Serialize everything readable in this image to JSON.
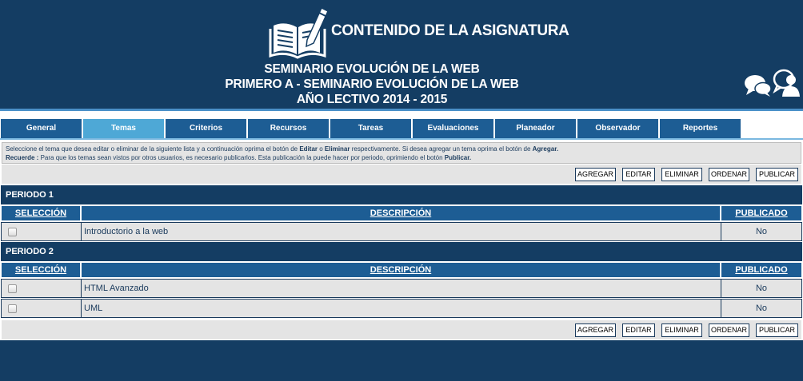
{
  "header": {
    "app_title": "CONTENIDO DE LA ASIGNATURA",
    "course_line1": "SEMINARIO EVOLUCIÓN DE LA WEB",
    "course_line2": "PRIMERO A - SEMINARIO EVOLUCIÓN DE LA WEB",
    "course_line3": "AÑO LECTIVO 2014 - 2015",
    "logo_icon": "book-pencil-icon",
    "chat_icon": "chat-bubbles-icon",
    "user_icon": "user-bubble-icon"
  },
  "tabs": [
    {
      "label": "General",
      "active": false
    },
    {
      "label": "Temas",
      "active": true
    },
    {
      "label": "Criterios",
      "active": false
    },
    {
      "label": "Recursos",
      "active": false
    },
    {
      "label": "Tareas",
      "active": false
    },
    {
      "label": "Evaluaciones",
      "active": false
    },
    {
      "label": "Planeador",
      "active": false
    },
    {
      "label": "Observador",
      "active": false
    },
    {
      "label": "Reportes",
      "active": false
    }
  ],
  "instructions": {
    "l1_a": "Seleccione el tema que desea editar o eliminar de la siguiente lista y a continuación oprima el botón de ",
    "l1_editar": "Editar",
    "l1_o": " o ",
    "l1_eliminar": "Eliminar",
    "l1_b": " respectivamente. Si desea agregar un tema oprima el botón de ",
    "l1_agregar": "Agregar.",
    "l2_recuerde": "Recuerde :",
    "l2_text": " Para que los temas sean vistos por otros usuarios, es necesario publicarlos. Esta publicación la puede hacer por periodo, oprimiendo el botón ",
    "l2_publicar": "Publicar."
  },
  "toolbar": {
    "agregar": "AGREGAR",
    "editar": "EDITAR",
    "eliminar": "ELIMINAR",
    "ordenar": "ORDENAR",
    "publicar": "PUBLICAR"
  },
  "columns": {
    "seleccion": "SELECCIÓN",
    "descripcion": "DESCRIPCIÓN",
    "publicado": "PUBLICADO"
  },
  "periods": [
    {
      "title": "PERIODO 1",
      "rows": [
        {
          "descripcion": "Introductorio a la web",
          "publicado": "No"
        }
      ]
    },
    {
      "title": "PERIODO 2",
      "rows": [
        {
          "descripcion": "HTML Avanzado",
          "publicado": "No"
        },
        {
          "descripcion": "UML",
          "publicado": "No"
        }
      ]
    }
  ],
  "colors": {
    "header_bg": "#143d63",
    "tab_bg": "#1d5d94",
    "tab_active": "#4ea8d6",
    "panel_bg": "#e4e4e4"
  }
}
